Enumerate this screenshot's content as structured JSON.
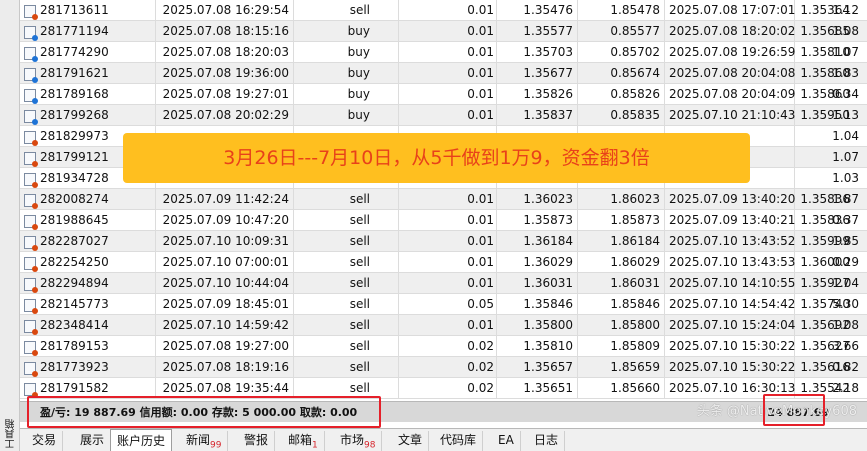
{
  "toolbox_label": "工具箱",
  "rows": [
    {
      "ticket": "281713611",
      "open_time": "2025.07.08 16:29:54",
      "type": "sell",
      "volume": "0.01",
      "open_price": "1.35476",
      "col6": "1.85478",
      "close_time": "2025.07.08 17:07:01",
      "close_price": "1.35364",
      "profit": "1.12"
    },
    {
      "ticket": "281771194",
      "open_time": "2025.07.08 18:15:16",
      "type": "buy",
      "volume": "0.01",
      "open_price": "1.35577",
      "col6": "0.85577",
      "close_time": "2025.07.08 18:20:02",
      "close_price": "1.35685",
      "profit": "1.08"
    },
    {
      "ticket": "281774290",
      "open_time": "2025.07.08 18:20:03",
      "type": "buy",
      "volume": "0.01",
      "open_price": "1.35703",
      "col6": "0.85702",
      "close_time": "2025.07.08 19:26:59",
      "close_price": "1.35810",
      "profit": "1.07"
    },
    {
      "ticket": "281791621",
      "open_time": "2025.07.08 19:36:00",
      "type": "buy",
      "volume": "0.01",
      "open_price": "1.35677",
      "col6": "0.85674",
      "close_time": "2025.07.08 20:04:08",
      "close_price": "1.35860",
      "profit": "1.83"
    },
    {
      "ticket": "281789168",
      "open_time": "2025.07.08 19:27:01",
      "type": "buy",
      "volume": "0.01",
      "open_price": "1.35826",
      "col6": "0.85826",
      "close_time": "2025.07.08 20:04:09",
      "close_price": "1.35860",
      "profit": "0.34"
    },
    {
      "ticket": "281799268",
      "open_time": "2025.07.08 20:02:29",
      "type": "buy",
      "volume": "0.01",
      "open_price": "1.35837",
      "col6": "0.85835",
      "close_time": "2025.07.10 21:10:43",
      "close_price": "1.35950",
      "profit": "1.13"
    },
    {
      "ticket": "281829973",
      "open_time": "",
      "type": "",
      "volume": "",
      "open_price": "",
      "col6": "",
      "close_time": "",
      "close_price": "",
      "profit": "1.04"
    },
    {
      "ticket": "281799121",
      "open_time": "",
      "type": "",
      "volume": "",
      "open_price": "",
      "col6": "",
      "close_time": "",
      "close_price": "",
      "profit": "1.07"
    },
    {
      "ticket": "281934728",
      "open_time": "",
      "type": "",
      "volume": "",
      "open_price": "",
      "col6": "",
      "close_time": "",
      "close_price": "",
      "profit": "1.03"
    },
    {
      "ticket": "282008274",
      "open_time": "2025.07.09 11:42:24",
      "type": "sell",
      "volume": "0.01",
      "open_price": "1.36023",
      "col6": "1.86023",
      "close_time": "2025.07.09 13:40:20",
      "close_price": "1.35836",
      "profit": "1.87"
    },
    {
      "ticket": "281988645",
      "open_time": "2025.07.09 10:47:20",
      "type": "sell",
      "volume": "0.01",
      "open_price": "1.35873",
      "col6": "1.85873",
      "close_time": "2025.07.09 13:40:21",
      "close_price": "1.35836",
      "profit": "0.37"
    },
    {
      "ticket": "282287027",
      "open_time": "2025.07.10 10:09:31",
      "type": "sell",
      "volume": "0.01",
      "open_price": "1.36184",
      "col6": "1.86184",
      "close_time": "2025.07.10 13:43:52",
      "close_price": "1.35999",
      "profit": "1.85"
    },
    {
      "ticket": "282254250",
      "open_time": "2025.07.10 07:00:01",
      "type": "sell",
      "volume": "0.01",
      "open_price": "1.36029",
      "col6": "1.86029",
      "close_time": "2025.07.10 13:43:53",
      "close_price": "1.36000",
      "profit": "0.29"
    },
    {
      "ticket": "282294894",
      "open_time": "2025.07.10 10:44:04",
      "type": "sell",
      "volume": "0.01",
      "open_price": "1.36031",
      "col6": "1.86031",
      "close_time": "2025.07.10 14:10:55",
      "close_price": "1.35927",
      "profit": "1.04"
    },
    {
      "ticket": "282145773",
      "open_time": "2025.07.09 18:45:01",
      "type": "sell",
      "volume": "0.05",
      "open_price": "1.35846",
      "col6": "1.85846",
      "close_time": "2025.07.10 14:54:42",
      "close_price": "1.35740",
      "profit": "5.30"
    },
    {
      "ticket": "282348414",
      "open_time": "2025.07.10 14:59:42",
      "type": "sell",
      "volume": "0.01",
      "open_price": "1.35800",
      "col6": "1.85800",
      "close_time": "2025.07.10 15:24:04",
      "close_price": "1.35692",
      "profit": "1.08"
    },
    {
      "ticket": "281789153",
      "open_time": "2025.07.08 19:27:00",
      "type": "sell",
      "volume": "0.02",
      "open_price": "1.35810",
      "col6": "1.85809",
      "close_time": "2025.07.10 15:30:22",
      "close_price": "1.35627",
      "profit": "3.66"
    },
    {
      "ticket": "281773923",
      "open_time": "2025.07.08 18:19:16",
      "type": "sell",
      "volume": "0.02",
      "open_price": "1.35657",
      "col6": "1.85659",
      "close_time": "2025.07.10 15:30:22",
      "close_price": "1.35616",
      "profit": "0.82"
    },
    {
      "ticket": "281791582",
      "open_time": "2025.07.08 19:35:44",
      "type": "sell",
      "volume": "0.02",
      "open_price": "1.35651",
      "col6": "1.85660",
      "close_time": "2025.07.10 16:30:13",
      "close_price": "1.35542",
      "profit": "2.18"
    }
  ],
  "banner": "3月26日---7月10日，从5千做到1万9，资金翻3倍",
  "summary": {
    "text": "盈/亏: 19 887.69  信用额: 0.00  存款: 5 000.00  取款: 0.00",
    "total": "24 887.69"
  },
  "watermark": "头条 @NativeMonkey608",
  "tabs": [
    {
      "label": "交易",
      "badge": ""
    },
    {
      "label": "展示",
      "badge": ""
    },
    {
      "label": "账户历史",
      "badge": ""
    },
    {
      "label": "新闻",
      "badge": "99"
    },
    {
      "label": "警报",
      "badge": ""
    },
    {
      "label": "邮箱",
      "badge": "1"
    },
    {
      "label": "市场",
      "badge": "98"
    },
    {
      "label": "文章",
      "badge": ""
    },
    {
      "label": "代码库",
      "badge": ""
    },
    {
      "label": "EA",
      "badge": ""
    },
    {
      "label": "日志",
      "badge": ""
    }
  ],
  "active_tab": "账户历史",
  "colors": {
    "banner_bg": "#ffbf1f",
    "banner_text": "#e8411a",
    "highlight_box": "#e5202a",
    "badge": "#d6262d"
  }
}
